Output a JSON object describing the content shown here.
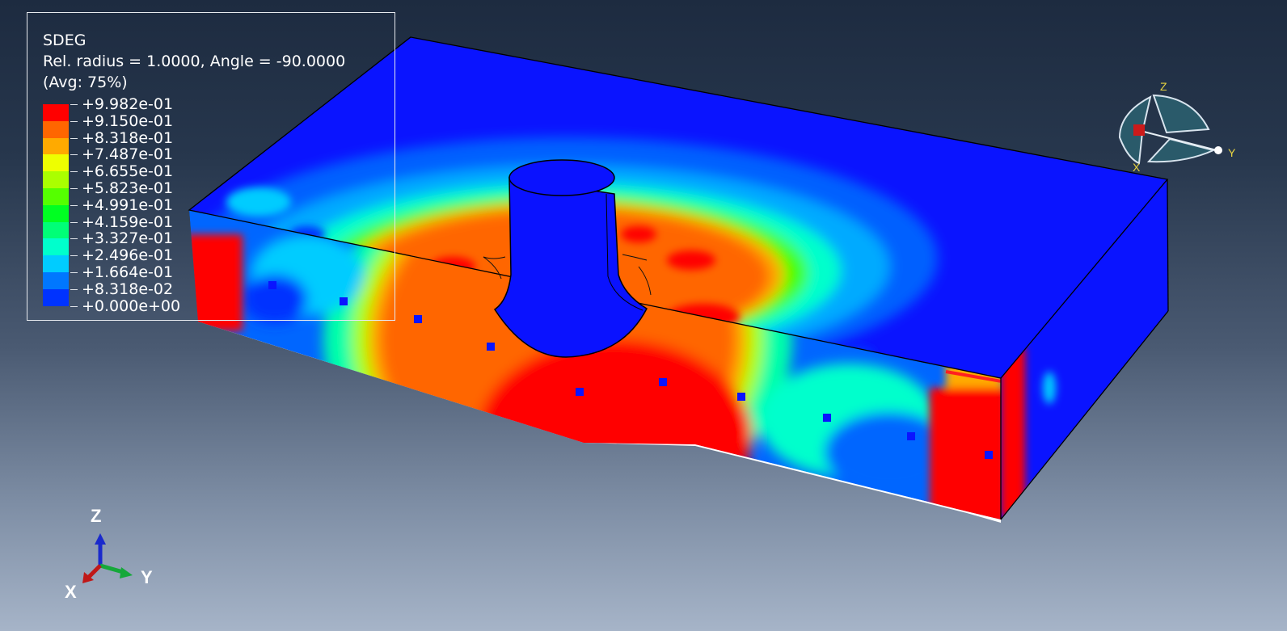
{
  "legend": {
    "variable": "SDEG",
    "section": "Rel. radius = 1.0000, Angle = -90.0000",
    "averaging": "(Avg: 75%)",
    "colors": [
      "#ff0000",
      "#ff6600",
      "#ffaa00",
      "#eeff00",
      "#aaff00",
      "#55ff00",
      "#00ff22",
      "#00ff77",
      "#00ffcc",
      "#00ccff",
      "#0077ff",
      "#0033ff"
    ],
    "labels": [
      "+9.982e-01",
      "+9.150e-01",
      "+8.318e-01",
      "+7.487e-01",
      "+6.655e-01",
      "+5.823e-01",
      "+4.991e-01",
      "+4.159e-01",
      "+3.327e-01",
      "+2.496e-01",
      "+1.664e-01",
      "+8.318e-02",
      "+0.000e+00"
    ]
  },
  "triad": {
    "z_label": "Z",
    "y_label": "Y",
    "x_label": "X"
  },
  "view_cube": {
    "z_label": "Z",
    "y_label": "Y",
    "x_label": "X"
  }
}
